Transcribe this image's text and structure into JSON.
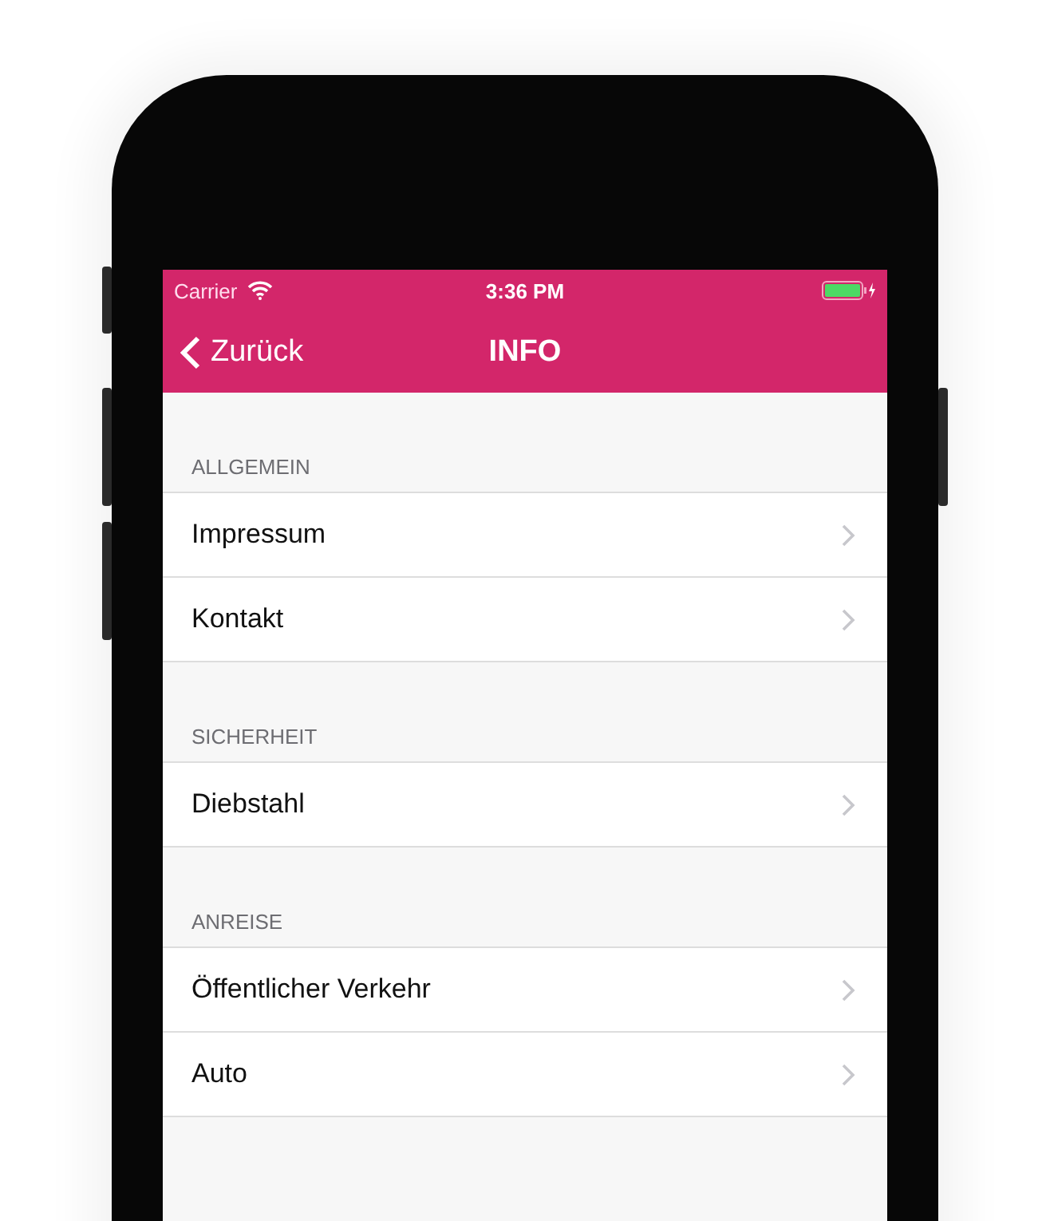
{
  "status_bar": {
    "carrier": "Carrier",
    "time": "3:36 PM"
  },
  "nav_bar": {
    "back": "Zurück",
    "title": "INFO"
  },
  "sections": [
    {
      "header": "ALLGEMEIN",
      "items": [
        {
          "label": "Impressum"
        },
        {
          "label": "Kontakt"
        }
      ]
    },
    {
      "header": "SICHERHEIT",
      "items": [
        {
          "label": "Diebstahl"
        }
      ]
    },
    {
      "header": "ANREISE",
      "items": [
        {
          "label": "Öffentlicher Verkehr"
        },
        {
          "label": "Auto"
        }
      ]
    }
  ]
}
